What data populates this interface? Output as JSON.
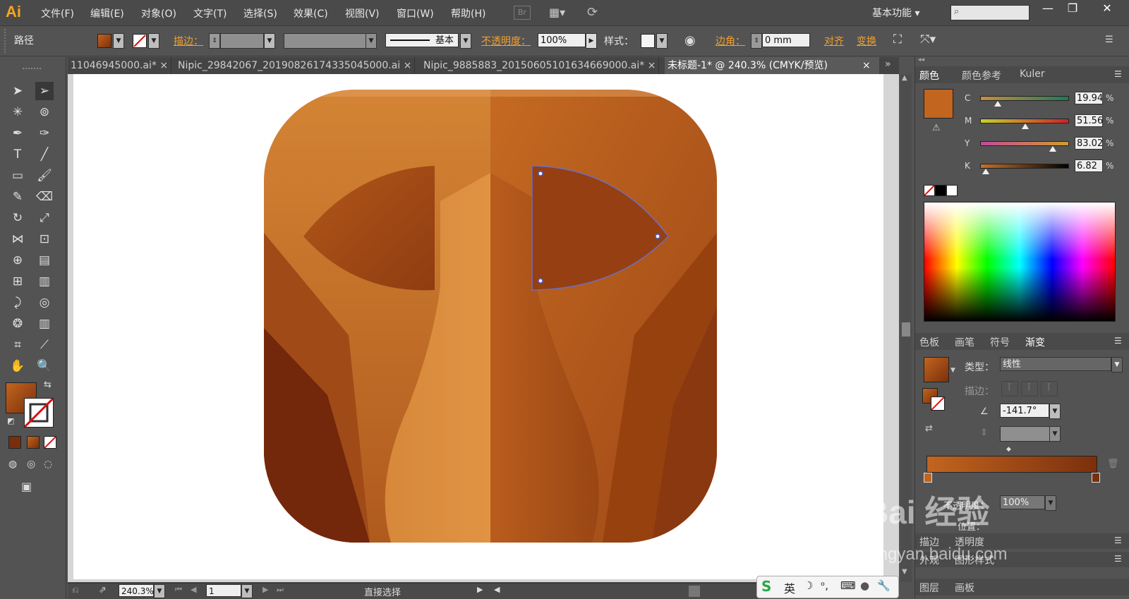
{
  "app": {
    "logo": "Ai"
  },
  "menu": [
    "文件(F)",
    "编辑(E)",
    "对象(O)",
    "文字(T)",
    "选择(S)",
    "效果(C)",
    "视图(V)",
    "窗口(W)",
    "帮助(H)"
  ],
  "menubar": {
    "bridge": "Br",
    "workspace": "基本功能 ▾",
    "search_icon": "⌕"
  },
  "window_buttons": [
    "—",
    "❐",
    "✕"
  ],
  "control": {
    "object_type": "路径",
    "stroke_label": "描边：",
    "stroke_style": "基本",
    "opacity_label": "不透明度：",
    "opacity_value": "100%",
    "style_label": "样式：",
    "corner_label": "边角：",
    "corner_value": "0 mm",
    "align_label": "对齐",
    "transform_label": "变换"
  },
  "tabs": [
    {
      "label": "11046945000.ai* ×",
      "active": false
    },
    {
      "label": "Nipic_29842067_20190826174335045000.ai ×",
      "active": false
    },
    {
      "label": "Nipic_9885883_20150605101634669000.ai* ×",
      "active": false
    },
    {
      "label": "未标题-1* @ 240.3% (CMYK/预览)",
      "active": true
    },
    {
      "label": "×",
      "active": false
    }
  ],
  "status": {
    "zoom": "240.3%",
    "page": "1",
    "tool_name": "直接选择"
  },
  "color_panel": {
    "tabs": [
      "颜色",
      "颜色参考",
      "Kuler"
    ],
    "fill_color": "#c2651f",
    "channels": [
      {
        "name": "C",
        "value": "19.94",
        "level": 0.1994
      },
      {
        "name": "M",
        "value": "51.56",
        "level": 0.5156
      },
      {
        "name": "Y",
        "value": "83.02",
        "level": 0.8302
      },
      {
        "name": "K",
        "value": "6.82",
        "level": 0.0682
      }
    ],
    "percent_sign": "%"
  },
  "gradient_panel": {
    "tabs": [
      "色板",
      "画笔",
      "符号",
      "渐变"
    ],
    "type_label": "类型：",
    "type_value": "线性",
    "stroke_label": "描边：",
    "angle_value": "-141.7°",
    "opacity_label": "不透明度：",
    "opacity_value": "100%",
    "location_label": "位置："
  },
  "lower_panels": [
    {
      "tabs": [
        "描边",
        "透明度"
      ]
    },
    {
      "tabs": [
        "外观",
        "图形样式"
      ]
    },
    {
      "tabs": [
        "图层",
        "画板"
      ]
    }
  ],
  "watermark": {
    "line1": "Bai 经验",
    "line2": "jingyan.baidu.com"
  },
  "ime": {
    "lang": "英"
  },
  "artwork_colors": {
    "light": "#d98a38",
    "mid": "#b95a1c",
    "dark": "#8a3410",
    "darkest": "#6b240b"
  }
}
